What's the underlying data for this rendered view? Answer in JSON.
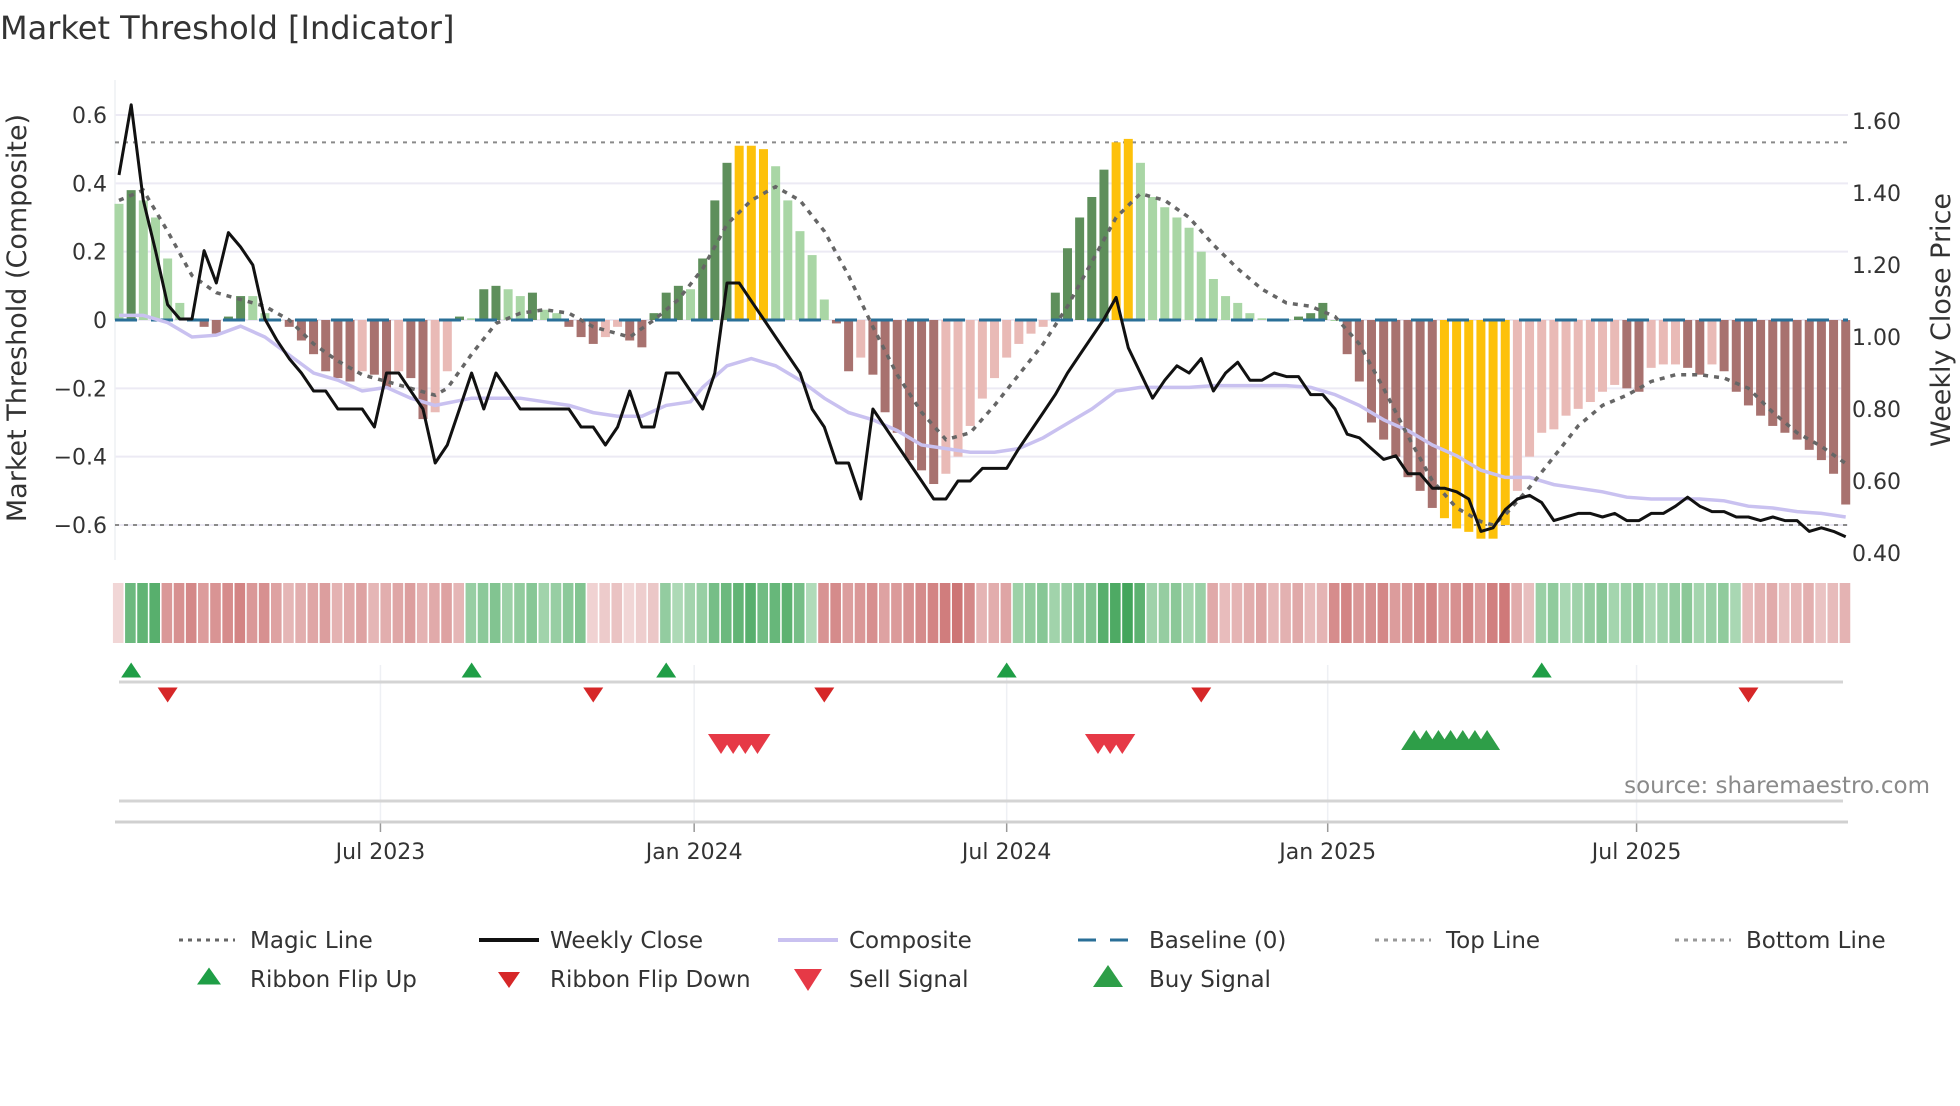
{
  "chart_data": {
    "type": "bar",
    "title": "Market Threshold [Indicator]",
    "ylabel": "Market Threshold (Composite)",
    "ylabel_right": "Weekly Close Price",
    "ylim": [
      -0.7,
      0.68
    ],
    "ylim_right": [
      0.38,
      1.68
    ],
    "yticks": [
      "0.6",
      "0.4",
      "0.2",
      "0",
      "−0.2",
      "−0.4",
      "−0.6"
    ],
    "ytick_values": [
      0.6,
      0.4,
      0.2,
      0,
      -0.2,
      -0.4,
      -0.6
    ],
    "yticks_right": [
      "1.60",
      "1.40",
      "1.20",
      "1.00",
      "0.80",
      "0.60",
      "0.40"
    ],
    "ytick_right_values": [
      1.6,
      1.4,
      1.2,
      1.0,
      0.8,
      0.6,
      0.4
    ],
    "xticks": [
      {
        "label": "Jul 2023",
        "week_index": 21.5
      },
      {
        "label": "Jan 2024",
        "week_index": 47.3
      },
      {
        "label": "Jul 2024",
        "week_index": 73.0
      },
      {
        "label": "Jan 2025",
        "week_index": 99.4
      },
      {
        "label": "Jul 2025",
        "week_index": 124.8
      }
    ],
    "grid": true,
    "top_line": 0.52,
    "bottom_line": -0.6,
    "baseline": 0,
    "yellow_threshold_high": 0.5,
    "yellow_threshold_low": -0.57,
    "composite_bars": [
      0.34,
      0.38,
      0.35,
      0.3,
      0.18,
      0.05,
      0.005,
      -0.02,
      -0.04,
      0.01,
      0.07,
      0.07,
      0.02,
      0.0,
      -0.02,
      -0.06,
      -0.1,
      -0.15,
      -0.17,
      -0.18,
      -0.15,
      -0.16,
      -0.2,
      -0.15,
      -0.17,
      -0.29,
      -0.27,
      -0.15,
      0.01,
      0.005,
      0.09,
      0.1,
      0.09,
      0.07,
      0.08,
      0.03,
      0.02,
      -0.02,
      -0.05,
      -0.07,
      -0.05,
      -0.02,
      -0.06,
      -0.08,
      0.02,
      0.08,
      0.1,
      0.09,
      0.18,
      0.35,
      0.46,
      0.51,
      0.51,
      0.5,
      0.45,
      0.35,
      0.26,
      0.19,
      0.06,
      -0.01,
      -0.15,
      -0.11,
      -0.16,
      -0.27,
      -0.33,
      -0.41,
      -0.44,
      -0.48,
      -0.45,
      -0.4,
      -0.31,
      -0.23,
      -0.17,
      -0.11,
      -0.07,
      -0.04,
      -0.02,
      0.08,
      0.21,
      0.3,
      0.36,
      0.44,
      0.52,
      0.53,
      0.46,
      0.36,
      0.33,
      0.3,
      0.27,
      0.2,
      0.12,
      0.07,
      0.05,
      0.02,
      0.005,
      0.003,
      0.002,
      0.01,
      0.02,
      0.05,
      0.0,
      -0.1,
      -0.18,
      -0.3,
      -0.35,
      -0.4,
      -0.46,
      -0.5,
      -0.55,
      -0.58,
      -0.61,
      -0.62,
      -0.64,
      -0.64,
      -0.6,
      -0.5,
      -0.4,
      -0.33,
      -0.32,
      -0.28,
      -0.26,
      -0.24,
      -0.21,
      -0.19,
      -0.2,
      -0.21,
      -0.14,
      -0.13,
      -0.13,
      -0.14,
      -0.16,
      -0.13,
      -0.15,
      -0.21,
      -0.25,
      -0.28,
      -0.31,
      -0.33,
      -0.35,
      -0.38,
      -0.41,
      -0.45,
      -0.54
    ],
    "weekly_close": [
      1.45,
      1.645,
      1.38,
      1.24,
      1.09,
      1.05,
      1.05,
      1.24,
      1.15,
      1.29,
      1.25,
      1.2,
      1.05,
      0.99,
      0.94,
      0.9,
      0.85,
      0.85,
      0.8,
      0.8,
      0.8,
      0.75,
      0.9,
      0.9,
      0.85,
      0.8,
      0.65,
      0.7,
      0.8,
      0.9,
      0.8,
      0.9,
      0.85,
      0.8,
      0.8,
      0.8,
      0.8,
      0.8,
      0.75,
      0.75,
      0.7,
      0.75,
      0.85,
      0.75,
      0.75,
      0.9,
      0.9,
      0.85,
      0.8,
      0.9,
      1.15,
      1.15,
      1.1,
      1.05,
      1.0,
      0.95,
      0.9,
      0.8,
      0.75,
      0.65,
      0.65,
      0.55,
      0.8,
      0.75,
      0.7,
      0.65,
      0.6,
      0.55,
      0.55,
      0.6,
      0.6,
      0.635,
      0.635,
      0.635,
      0.69,
      0.74,
      0.79,
      0.84,
      0.9,
      0.95,
      1.0,
      1.05,
      1.11,
      0.97,
      0.9,
      0.83,
      0.88,
      0.92,
      0.9,
      0.94,
      0.85,
      0.9,
      0.93,
      0.88,
      0.88,
      0.9,
      0.89,
      0.89,
      0.84,
      0.84,
      0.8,
      0.73,
      0.72,
      0.69,
      0.66,
      0.67,
      0.62,
      0.62,
      0.58,
      0.58,
      0.57,
      0.55,
      0.46,
      0.47,
      0.52,
      0.55,
      0.56,
      0.54,
      0.49,
      0.5,
      0.51,
      0.51,
      0.5,
      0.51,
      0.49,
      0.49,
      0.51,
      0.51,
      0.53,
      0.555,
      0.53,
      0.515,
      0.515,
      0.5,
      0.5,
      0.49,
      0.5,
      0.49,
      0.49,
      0.46,
      0.47,
      0.46,
      0.445
    ],
    "magic_line": [
      [
        0,
        0.35
      ],
      [
        2,
        0.38
      ],
      [
        4,
        0.26
      ],
      [
        6,
        0.13
      ],
      [
        8,
        0.08
      ],
      [
        10,
        0.06
      ],
      [
        12,
        0.04
      ],
      [
        14,
        0.0
      ],
      [
        16,
        -0.07
      ],
      [
        18,
        -0.12
      ],
      [
        20,
        -0.16
      ],
      [
        22,
        -0.18
      ],
      [
        24,
        -0.2
      ],
      [
        26,
        -0.22
      ],
      [
        27,
        -0.2
      ],
      [
        29,
        -0.1
      ],
      [
        31,
        -0.01
      ],
      [
        33,
        0.02
      ],
      [
        35,
        0.03
      ],
      [
        37,
        0.02
      ],
      [
        39,
        -0.02
      ],
      [
        41,
        -0.04
      ],
      [
        42,
        -0.05
      ],
      [
        44,
        0.0
      ],
      [
        46,
        0.06
      ],
      [
        48,
        0.15
      ],
      [
        50,
        0.28
      ],
      [
        52,
        0.35
      ],
      [
        54,
        0.39
      ],
      [
        56,
        0.35
      ],
      [
        58,
        0.26
      ],
      [
        60,
        0.13
      ],
      [
        62,
        -0.02
      ],
      [
        64,
        -0.16
      ],
      [
        66,
        -0.27
      ],
      [
        68,
        -0.35
      ],
      [
        70,
        -0.33
      ],
      [
        72,
        -0.25
      ],
      [
        74,
        -0.16
      ],
      [
        76,
        -0.07
      ],
      [
        78,
        0.04
      ],
      [
        80,
        0.17
      ],
      [
        82,
        0.3
      ],
      [
        84,
        0.37
      ],
      [
        86,
        0.35
      ],
      [
        88,
        0.3
      ],
      [
        90,
        0.22
      ],
      [
        92,
        0.15
      ],
      [
        94,
        0.09
      ],
      [
        96,
        0.05
      ],
      [
        98,
        0.04
      ],
      [
        100,
        0.01
      ],
      [
        102,
        -0.07
      ],
      [
        104,
        -0.2
      ],
      [
        106,
        -0.34
      ],
      [
        108,
        -0.47
      ],
      [
        110,
        -0.55
      ],
      [
        112,
        -0.59
      ],
      [
        113,
        -0.6
      ],
      [
        114,
        -0.57
      ],
      [
        116,
        -0.49
      ],
      [
        118,
        -0.4
      ],
      [
        120,
        -0.31
      ],
      [
        122,
        -0.25
      ],
      [
        124,
        -0.22
      ],
      [
        126,
        -0.18
      ],
      [
        128,
        -0.16
      ],
      [
        130,
        -0.16
      ],
      [
        132,
        -0.17
      ],
      [
        134,
        -0.2
      ],
      [
        136,
        -0.27
      ],
      [
        138,
        -0.33
      ],
      [
        140,
        -0.37
      ],
      [
        142,
        -0.42
      ]
    ],
    "composite_line": [
      [
        0,
        1.06
      ],
      [
        2,
        1.06
      ],
      [
        4,
        1.04
      ],
      [
        6,
        1.0
      ],
      [
        8,
        1.005
      ],
      [
        10,
        1.03
      ],
      [
        12,
        1.0
      ],
      [
        14,
        0.95
      ],
      [
        16,
        0.9
      ],
      [
        18,
        0.88
      ],
      [
        20,
        0.85
      ],
      [
        22,
        0.86
      ],
      [
        24,
        0.83
      ],
      [
        26,
        0.81
      ],
      [
        29,
        0.83
      ],
      [
        31,
        0.83
      ],
      [
        33,
        0.83
      ],
      [
        35,
        0.82
      ],
      [
        37,
        0.81
      ],
      [
        39,
        0.79
      ],
      [
        41,
        0.78
      ],
      [
        43,
        0.78
      ],
      [
        45,
        0.81
      ],
      [
        47,
        0.82
      ],
      [
        48,
        0.86
      ],
      [
        50,
        0.92
      ],
      [
        52,
        0.94
      ],
      [
        54,
        0.92
      ],
      [
        56,
        0.88
      ],
      [
        58,
        0.83
      ],
      [
        60,
        0.79
      ],
      [
        62,
        0.77
      ],
      [
        64,
        0.74
      ],
      [
        66,
        0.7
      ],
      [
        68,
        0.69
      ],
      [
        70,
        0.68
      ],
      [
        72,
        0.68
      ],
      [
        74,
        0.69
      ],
      [
        76,
        0.72
      ],
      [
        78,
        0.76
      ],
      [
        80,
        0.8
      ],
      [
        82,
        0.85
      ],
      [
        84,
        0.86
      ],
      [
        86,
        0.86
      ],
      [
        88,
        0.86
      ],
      [
        90,
        0.865
      ],
      [
        92,
        0.865
      ],
      [
        94,
        0.865
      ],
      [
        96,
        0.865
      ],
      [
        98,
        0.86
      ],
      [
        100,
        0.84
      ],
      [
        102,
        0.81
      ],
      [
        104,
        0.77
      ],
      [
        106,
        0.74
      ],
      [
        108,
        0.7
      ],
      [
        110,
        0.67
      ],
      [
        112,
        0.63
      ],
      [
        114,
        0.61
      ],
      [
        116,
        0.61
      ],
      [
        118,
        0.59
      ],
      [
        120,
        0.58
      ],
      [
        122,
        0.57
      ],
      [
        124,
        0.555
      ],
      [
        126,
        0.55
      ],
      [
        128,
        0.55
      ],
      [
        130,
        0.55
      ],
      [
        132,
        0.545
      ],
      [
        134,
        0.53
      ],
      [
        136,
        0.525
      ],
      [
        138,
        0.515
      ],
      [
        140,
        0.51
      ],
      [
        142,
        0.5
      ]
    ],
    "ribbon": [
      {
        "from": 0,
        "to": 0,
        "strength": -0.15
      },
      {
        "from": 1,
        "to": 3,
        "strength": 0.7
      },
      {
        "from": 4,
        "to": 12,
        "strength": -0.6
      },
      {
        "from": 13,
        "to": 28,
        "strength": -0.4
      },
      {
        "from": 29,
        "to": 38,
        "strength": 0.45
      },
      {
        "from": 39,
        "to": 44,
        "strength": -0.15
      },
      {
        "from": 45,
        "to": 48,
        "strength": 0.35
      },
      {
        "from": 49,
        "to": 56,
        "strength": 0.7
      },
      {
        "from": 57,
        "to": 57,
        "strength": 0.3
      },
      {
        "from": 58,
        "to": 66,
        "strength": -0.55
      },
      {
        "from": 67,
        "to": 70,
        "strength": -0.75
      },
      {
        "from": 71,
        "to": 73,
        "strength": -0.35
      },
      {
        "from": 74,
        "to": 80,
        "strength": 0.45
      },
      {
        "from": 81,
        "to": 84,
        "strength": 0.85
      },
      {
        "from": 85,
        "to": 89,
        "strength": 0.4
      },
      {
        "from": 90,
        "to": 99,
        "strength": -0.35
      },
      {
        "from": 100,
        "to": 112,
        "strength": -0.6
      },
      {
        "from": 113,
        "to": 114,
        "strength": -0.75
      },
      {
        "from": 115,
        "to": 116,
        "strength": -0.3
      },
      {
        "from": 117,
        "to": 133,
        "strength": 0.4
      },
      {
        "from": 134,
        "to": 142,
        "strength": -0.3
      }
    ],
    "ribbon_flip_up": [
      1,
      29,
      45,
      73,
      117
    ],
    "ribbon_flip_down": [
      4,
      39,
      58,
      89,
      134
    ],
    "sell_signals": [
      50,
      51,
      52,
      53,
      81,
      82,
      83
    ],
    "buy_signals": [
      107,
      108,
      109,
      110,
      111,
      112,
      113
    ],
    "legend": [
      {
        "label": "Magic Line",
        "kind": "dotted",
        "color": "#666666"
      },
      {
        "label": "Weekly Close",
        "kind": "solid",
        "color": "#111111"
      },
      {
        "label": "Composite",
        "kind": "solid",
        "color": "#c9c1f0"
      },
      {
        "label": "Baseline (0)",
        "kind": "dashed",
        "color": "#2a6f97"
      },
      {
        "label": "Top Line",
        "kind": "dotted",
        "color": "#999999"
      },
      {
        "label": "Bottom Line",
        "kind": "dotted",
        "color": "#999999"
      },
      {
        "label": "Ribbon Flip Up",
        "kind": "tri-up",
        "color": "#1f9e46"
      },
      {
        "label": "Ribbon Flip Down",
        "kind": "tri-down",
        "color": "#d62728"
      },
      {
        "label": "Sell Signal",
        "kind": "tri-down-big",
        "color": "#e63946"
      },
      {
        "label": "Buy Signal",
        "kind": "tri-up-big",
        "color": "#2e9e48"
      }
    ],
    "legend_position": "bottom",
    "source": "source: sharemaestro.com",
    "colors": {
      "bar_pos_rising": "#5e8f5b",
      "bar_pos_falling": "#a9d6a5",
      "bar_neg_falling": "#a8726f",
      "bar_neg_rising": "#e9bab6",
      "bar_extreme": "#fdc10a"
    }
  }
}
